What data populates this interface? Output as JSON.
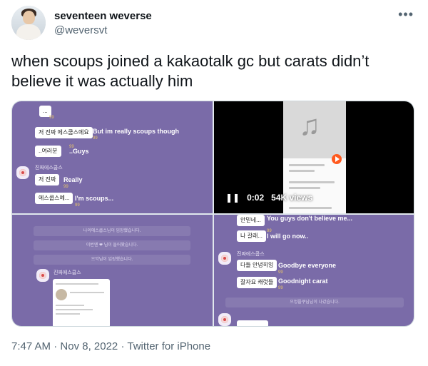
{
  "author": {
    "display_name": "seventeen weverse",
    "handle": "@weversvt"
  },
  "more_icon": "•••",
  "tweet": {
    "text": "when scoups joined a kakaotalk gc but carats didn’t believe it was actually him"
  },
  "media": {
    "panel1": {
      "bubbles": [
        "...",
        "저 진짜 에스쿱스에요",
        "..여러분",
        "저 진짜",
        "에스쿱스예..."
      ],
      "captions": [
        "But im really scoups though",
        "..Guys",
        "Really",
        "I'm scoups..."
      ],
      "read_counts": [
        "99",
        "99",
        "99",
        "99",
        "99"
      ],
      "sender": "진짜에스쿱스"
    },
    "panel2": {
      "duration": "0:02",
      "views": "54K views",
      "play_pause": "❚❚"
    },
    "panel3": {
      "system_messages": [
        "나의에스쿱스님이 입장했습니다.",
        "이번엔 ❤ 님이 들어왔습니다.",
        "으악님이 입장했습니다."
      ],
      "sender": "진짜에스쿱스"
    },
    "panel4": {
      "bubbles": [
        "안믿네...",
        "나 갈래...",
        "다들 안녕히잉",
        "잘자요 캐럿들"
      ],
      "captions": [
        "You guys don't believe me...",
        "I will go now..",
        "Goodbye everyone",
        "Goodnight carat"
      ],
      "read_counts": [
        "99",
        "99",
        "99",
        "99"
      ],
      "sender": "진짜에스쿱스",
      "system_message": "으엉을쿠님님이 나갔습니다."
    }
  },
  "footer": {
    "time": "7:47 AM",
    "separator": "·",
    "date": "Nov 8, 2022",
    "source": "Twitter for iPhone"
  }
}
